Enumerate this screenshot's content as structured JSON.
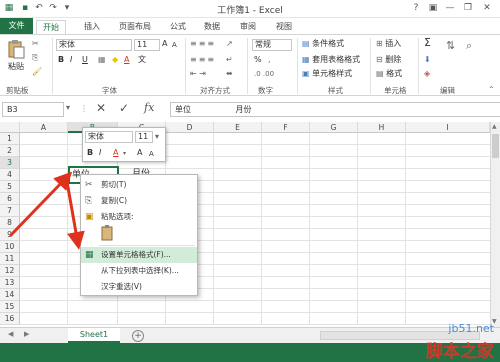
{
  "titlebar": {
    "title": "工作簿1 - Excel",
    "minimize": "—",
    "restore": "❐",
    "close": "✕",
    "help": "?",
    "ribbon_opts": "▣"
  },
  "tabs": [
    "文件",
    "开始",
    "插入",
    "页面布局",
    "公式",
    "数据",
    "审阅",
    "视图"
  ],
  "ribbon": {
    "paste_label": "粘贴",
    "clipboard_group": "剪贴板",
    "font_name": "宋体",
    "font_size": "11",
    "font_group": "字体",
    "align_group": "对齐方式",
    "number_format": "常规",
    "number_group": "数字",
    "cond_format": "条件格式",
    "table_format": "套用表格格式",
    "cell_style": "单元格样式",
    "styles_group": "样式",
    "insert_label": "插入",
    "delete_label": "删除",
    "format_label": "格式",
    "cells_group": "单元格",
    "edit_group": "编辑",
    "bold": "B",
    "italic": "I",
    "underline": "U",
    "font_color_letter": "A",
    "wen": "文",
    "percent": "%",
    "sigma": "Σ",
    "grow_font": "A",
    "shrink_font": "A",
    "sheet_label": "Sheet1"
  },
  "formula_bar": {
    "name_box": "B3",
    "fx": "fx",
    "cancel": "✕",
    "enter": "✓",
    "content_a": "单位",
    "content_b": "月份"
  },
  "columns": [
    "A",
    "B",
    "C",
    "D",
    "E",
    "F",
    "G",
    "H",
    "I"
  ],
  "rows": [
    "1",
    "2",
    "3",
    "4",
    "5",
    "6",
    "7",
    "8",
    "9",
    "10",
    "11",
    "12",
    "13",
    "14",
    "15",
    "16"
  ],
  "cells": {
    "b3": "单位",
    "c3": "月份"
  },
  "mini_toolbar": {
    "font": "宋体",
    "size": "11",
    "bold": "B",
    "italic": "I",
    "color": "A",
    "grow": "A",
    "shrink": "A"
  },
  "context_menu": {
    "cut": "剪切(T)",
    "copy": "复制(C)",
    "paste_options": "粘贴选项:",
    "format_cells": "设置单元格格式(F)...",
    "pick_list": "从下拉列表中选择(K)...",
    "pinyin": "汉字重选(V)"
  },
  "sheet_tabs": {
    "sheet1": "Sheet1",
    "add": "+",
    "prev": "◀",
    "next": "▶"
  },
  "watermark": {
    "site": "jb51.net",
    "name": "脚本之家"
  },
  "colors": {
    "excel_green": "#217346",
    "arrow_red": "#e0301e",
    "menu_highlight": "#d3ebd9"
  }
}
